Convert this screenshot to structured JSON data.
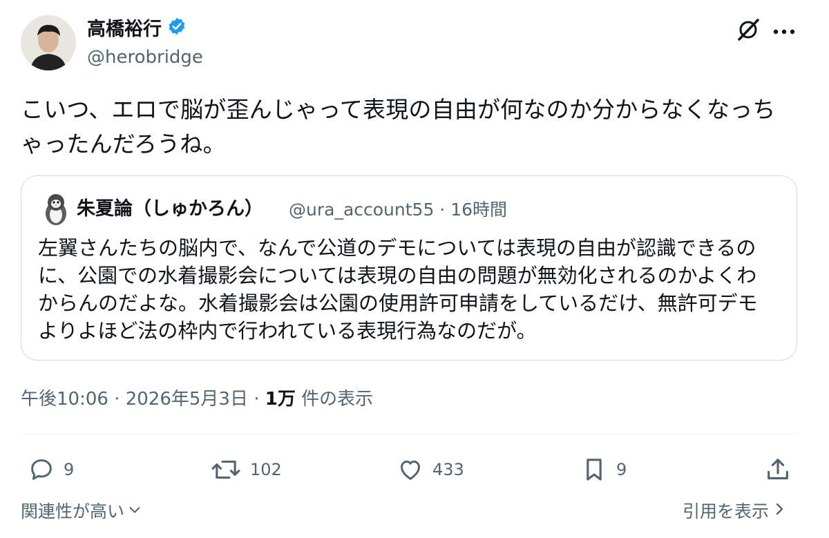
{
  "author": {
    "name": "高橋裕行",
    "handle": "@herobridge",
    "verified": true
  },
  "tweet": {
    "text_line1": "こいつ、エロで脳が歪んじゃって表現の自由が何なのか分からなくなっち",
    "text_line2": "ゃったんだろうね。"
  },
  "quote": {
    "name": "朱夏論（しゅかろん）",
    "meta": "@ura_account55 · 16時間",
    "lines": [
      "左翼さんたちの脳内で、なんで公道のデモについては表現の自由が認識できるの",
      "に、公園での水着撮影会については表現の自由の問題が無効化されるのかよくわ",
      "からんのだよな。水着撮影会は公園の使用許可申請をしているだけ、無許可デモ",
      "よりよほど法の枠内で行われている表現行為なのだが。"
    ]
  },
  "meta": {
    "time": "午後10:06 · 2026年5月3日 · ",
    "views_count": "1万",
    "views_label": " 件の表示"
  },
  "actions": {
    "replies": "9",
    "retweets": "102",
    "likes": "433",
    "bookmarks": "9"
  },
  "footer": {
    "sort_label": "関連性が高い",
    "view_quotes_label": "引用を表示"
  },
  "colors": {
    "text": "#0f1419",
    "secondary": "#536471",
    "border": "#cfd9de",
    "verified": "#1d9bf0"
  }
}
